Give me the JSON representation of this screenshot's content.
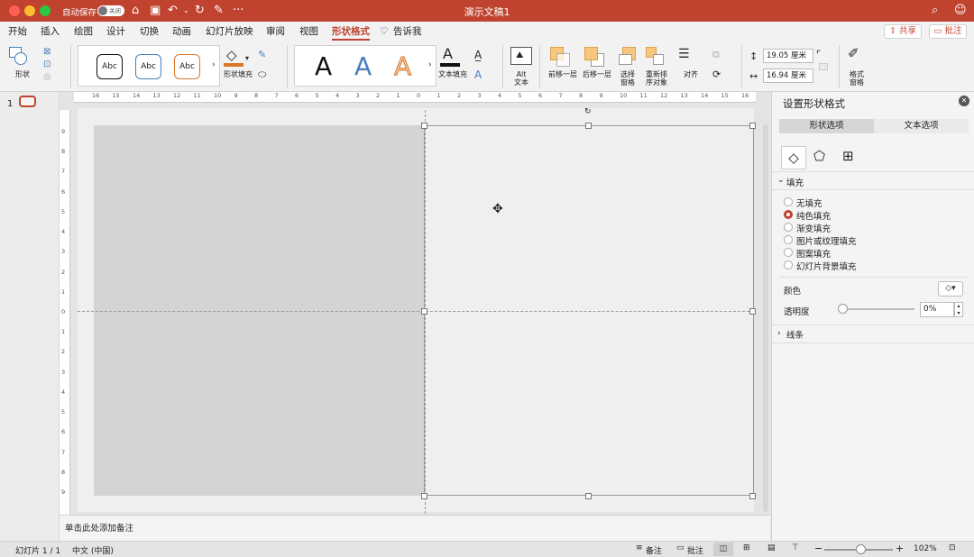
{
  "titlebar": {
    "autosave_label": "自动保存",
    "autosave_state": "关闭",
    "title": "演示文稿1",
    "more": "···"
  },
  "tabs": [
    "开始",
    "插入",
    "绘图",
    "设计",
    "切换",
    "动画",
    "幻灯片放映",
    "审阅",
    "视图",
    "形状格式"
  ],
  "tell_me": "告诉我",
  "share_label": "共享",
  "comment_label": "批注",
  "ribbon": {
    "shape_label": "形状",
    "abc_items": [
      "Abc",
      "Abc",
      "Abc"
    ],
    "shape_fill_label": "形状填充",
    "wordart_letter": "A",
    "text_fill_label": "文本填充",
    "alt_text_label": "Alt\n文本",
    "alt_text_line1": "Alt",
    "alt_text_line2": "文本",
    "bring_forward_label": "前移一层",
    "send_backward_label": "后移一层",
    "selection_pane_line1": "选择",
    "selection_pane_line2": "窗格",
    "reorder_line1": "重新排",
    "reorder_line2": "序对象",
    "align_label": "对齐",
    "height_value": "19.05 厘米",
    "width_value": "16.94 厘米",
    "format_pane_line1": "格式",
    "format_pane_line2": "窗格"
  },
  "slide_number": "1",
  "notes_placeholder": "单击此处添加备注",
  "pane": {
    "title": "设置形状格式",
    "tabs": [
      "形状选项",
      "文本选项"
    ],
    "fill_section": "填充",
    "fill_options": [
      "无填充",
      "纯色填充",
      "渐变填充",
      "图片或纹理填充",
      "图案填充",
      "幻灯片背景填充"
    ],
    "selected_fill": 1,
    "color_label": "颜色",
    "transparency_label": "透明度",
    "transparency_value": "0%",
    "transparency_level": 0,
    "line_section": "线条"
  },
  "ruler": {
    "top": [
      "16",
      "15",
      "14",
      "13",
      "12",
      "11",
      "10",
      "9",
      "8",
      "7",
      "6",
      "5",
      "4",
      "3",
      "2",
      "1",
      "0",
      "1",
      "2",
      "3",
      "4",
      "5",
      "6",
      "7",
      "8",
      "9",
      "10",
      "11",
      "12",
      "13",
      "14",
      "15",
      "16"
    ],
    "left": [
      "9",
      "8",
      "7",
      "6",
      "5",
      "4",
      "3",
      "2",
      "1",
      "0",
      "1",
      "2",
      "3",
      "4",
      "5",
      "6",
      "7",
      "8",
      "9"
    ]
  },
  "status": {
    "slide_info": "幻灯片 1 / 1",
    "language": "中文 (中国)",
    "notes_label": "备注",
    "comments_label": "批注",
    "zoom_value": "102%",
    "zoom_level": 0.52
  },
  "colors": {
    "accent": "#c0432f",
    "left_shape_fill": "#d4d4d4",
    "right_shape_fill": "#efefef"
  },
  "icons": [
    "home-icon",
    "save-icon",
    "undo-icon",
    "redo-icon",
    "edit-icon",
    "search-icon",
    "smiley-icon",
    "bulb-icon",
    "share-icon",
    "comment-icon",
    "fill-bucket-icon",
    "pentagon-icon",
    "size-properties-icon",
    "close-icon"
  ]
}
